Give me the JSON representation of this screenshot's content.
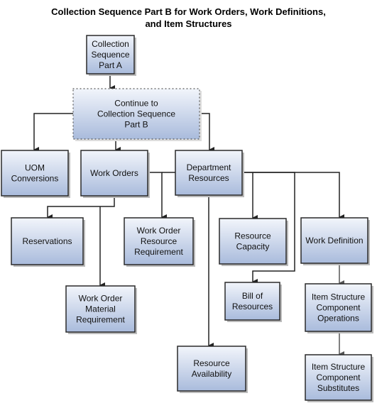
{
  "title": [
    "Collection Sequence Part B for Work Orders, Work Definitions,",
    "and Item Structures"
  ],
  "colors": {
    "box_top": "#f2f5fb",
    "box_bottom": "#a9bbdc",
    "border": "#2a2a2a",
    "line": "#222222",
    "gray_line": "#555555"
  },
  "nodes": [
    {
      "id": "part_a",
      "lines": [
        "Collection",
        "Sequence",
        "Part A"
      ]
    },
    {
      "id": "continue",
      "lines": [
        "Continue to",
        "Collection Sequence",
        "Part B"
      ],
      "dotted": true
    },
    {
      "id": "uom",
      "lines": [
        "UOM",
        "Conversions"
      ]
    },
    {
      "id": "work_orders",
      "lines": [
        "Work Orders"
      ]
    },
    {
      "id": "dept_res",
      "lines": [
        "Department",
        "Resources"
      ]
    },
    {
      "id": "reservations",
      "lines": [
        "Reservations"
      ]
    },
    {
      "id": "worr",
      "lines": [
        "Work Order",
        "Resource",
        "Requirement"
      ]
    },
    {
      "id": "res_capacity",
      "lines": [
        "Resource",
        "Capacity"
      ]
    },
    {
      "id": "work_def",
      "lines": [
        "Work Definition"
      ]
    },
    {
      "id": "womr",
      "lines": [
        "Work Order",
        "Material",
        "Requirement"
      ]
    },
    {
      "id": "bor",
      "lines": [
        "Bill of",
        "Resources"
      ]
    },
    {
      "id": "isco",
      "lines": [
        "Item Structure",
        "Component",
        "Operations"
      ]
    },
    {
      "id": "res_avail",
      "lines": [
        "Resource",
        "Availability"
      ]
    },
    {
      "id": "iscs",
      "lines": [
        "Item Structure",
        "Component",
        "Substitutes"
      ]
    }
  ],
  "edges": [
    [
      "part_a",
      "continue"
    ],
    [
      "continue",
      "uom"
    ],
    [
      "continue",
      "work_orders"
    ],
    [
      "continue",
      "dept_res"
    ],
    [
      "work_orders",
      "reservations"
    ],
    [
      "work_orders",
      "womr"
    ],
    [
      "work_orders",
      "worr"
    ],
    [
      "dept_res",
      "worr"
    ],
    [
      "dept_res",
      "res_capacity"
    ],
    [
      "dept_res",
      "bor"
    ],
    [
      "dept_res",
      "work_def"
    ],
    [
      "dept_res",
      "res_avail"
    ],
    [
      "work_def",
      "isco"
    ],
    [
      "isco",
      "iscs"
    ]
  ]
}
